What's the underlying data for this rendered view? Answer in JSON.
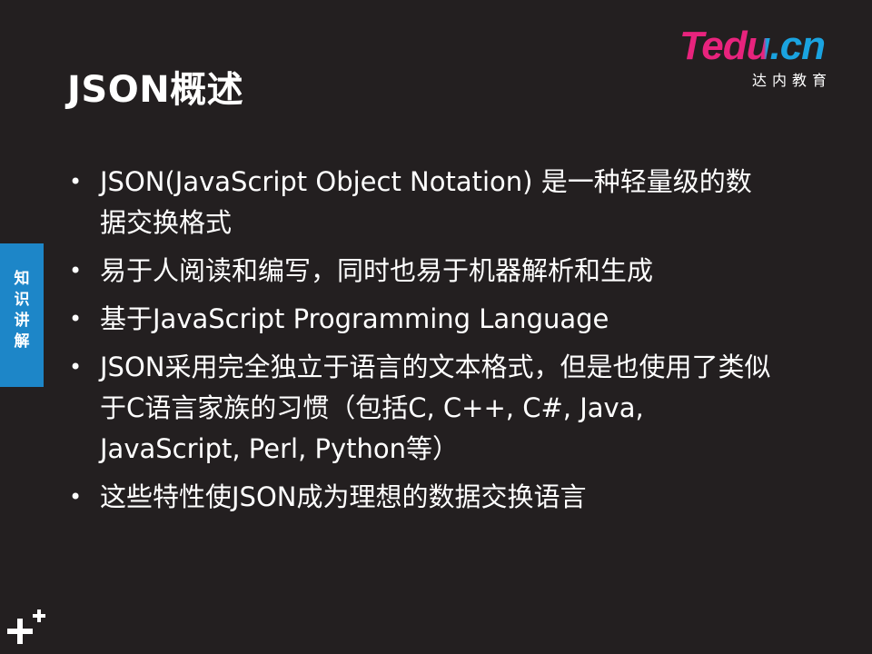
{
  "slide": {
    "title": "JSON概述",
    "logo": {
      "word": "Tedu.cn",
      "subtitle": "达内教育"
    },
    "side_tab": {
      "label": "知识讲解"
    },
    "bullets": [
      "JSON(JavaScript Object Notation) 是一种轻量级的数据交换格式",
      "易于人阅读和编写，同时也易于机器解析和生成",
      "基于JavaScript Programming Language",
      "JSON采用完全独立于语言的文本格式，但是也使用了类似于C语言家族的习惯（包括C, C++, C#, Java, JavaScript, Perl, Python等）",
      "这些特性使JSON成为理想的数据交换语言"
    ],
    "bullet_symbol": "•",
    "icons": {
      "corner": "plus-icon"
    },
    "colors": {
      "background": "#231f20",
      "brand_pink": "#e8237d",
      "brand_blue": "#1aa3e0",
      "tab_blue": "#1d86c8"
    }
  }
}
